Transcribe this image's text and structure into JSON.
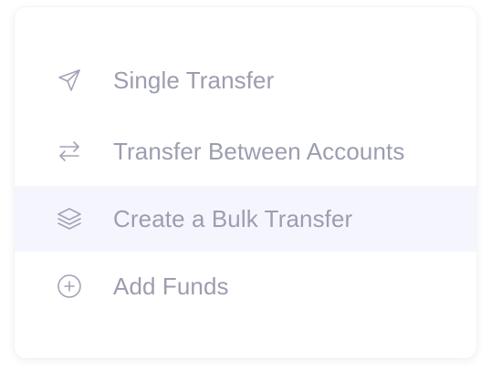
{
  "menu": {
    "items": [
      {
        "label": "Single Transfer",
        "icon": "send-icon",
        "active": false
      },
      {
        "label": "Transfer Between Accounts",
        "icon": "swap-arrows-icon",
        "active": false
      },
      {
        "label": "Create a Bulk Transfer",
        "icon": "layers-icon",
        "active": true
      },
      {
        "label": "Add Funds",
        "icon": "plus-circle-icon",
        "active": false
      }
    ]
  },
  "colors": {
    "item_text": "#9c9db0",
    "icon_stroke": "#a2a3b5",
    "active_background": "#f5f6fd",
    "card_background": "#ffffff"
  }
}
